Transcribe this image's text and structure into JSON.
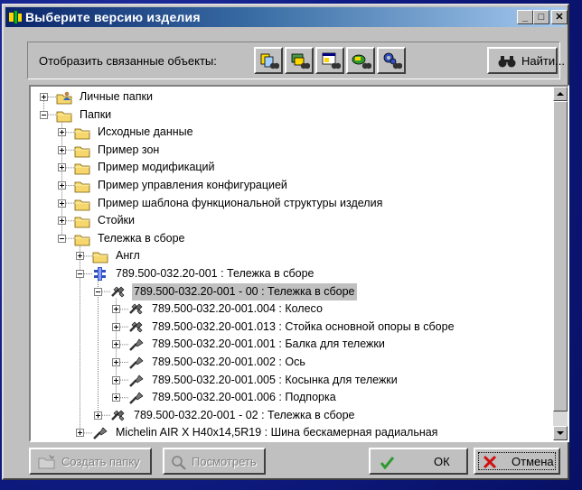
{
  "window": {
    "title": "Выберите версию изделия",
    "minimize_glyph": "_",
    "maximize_glyph": "□",
    "close_glyph": "✕"
  },
  "toolbar": {
    "related_label": "Отобразить связанные объекты:",
    "icon_buttons": [
      "link-objects-icon-1",
      "link-objects-icon-2",
      "link-objects-icon-3",
      "link-objects-icon-4",
      "link-objects-icon-5"
    ],
    "find_label": "Найти..."
  },
  "tree": {
    "nodes": [
      {
        "label": "Личные папки",
        "expander": "plus",
        "icon": "personal-folder-icon"
      },
      {
        "label": "Папки",
        "expander": "minus",
        "icon": "folder-icon"
      },
      {
        "label": "Исходные данные",
        "expander": "plus",
        "icon": "folder-icon"
      },
      {
        "label": "Пример зон",
        "expander": "plus",
        "icon": "folder-icon"
      },
      {
        "label": "Пример модификаций",
        "expander": "plus",
        "icon": "folder-icon"
      },
      {
        "label": "Пример управления конфигурацией",
        "expander": "plus",
        "icon": "folder-icon"
      },
      {
        "label": "Пример шаблона функциональной структуры изделия",
        "expander": "plus",
        "icon": "folder-icon"
      },
      {
        "label": "Стойки",
        "expander": "plus",
        "icon": "folder-icon"
      },
      {
        "label": "Тележка в сборе",
        "expander": "minus",
        "icon": "folder-icon"
      },
      {
        "label": "Англ",
        "expander": "plus",
        "icon": "folder-icon"
      },
      {
        "label": "789.500-032.20-001 : Тележка в сборе",
        "expander": "minus",
        "icon": "product-icon"
      },
      {
        "label": "789.500-032.20-001 - 00 : Тележка в сборе",
        "expander": "minus",
        "icon": "assembly-icon",
        "selected": true
      },
      {
        "label": "789.500-032.20-001.004 : Колесо",
        "expander": "plus",
        "icon": "assembly-icon"
      },
      {
        "label": "789.500-032.20-001.013 : Стойка основной опоры в сборе",
        "expander": "plus",
        "icon": "assembly-icon"
      },
      {
        "label": "789.500-032.20-001.001 : Балка для тележки",
        "expander": "plus",
        "icon": "part-icon"
      },
      {
        "label": "789.500-032.20-001.002 : Ось",
        "expander": "plus",
        "icon": "part-icon"
      },
      {
        "label": "789.500-032.20-001.005 : Косынка для тележки",
        "expander": "plus",
        "icon": "part-icon"
      },
      {
        "label": "789.500-032.20-001.006 : Подпорка",
        "expander": "plus",
        "icon": "part-icon"
      },
      {
        "label": "789.500-032.20-001 - 02 : Тележка в сборе",
        "expander": "plus",
        "icon": "assembly-icon"
      },
      {
        "label": "Michelin AIR X H40x14,5R19 : Шина бескамерная радиальная",
        "expander": "plus",
        "icon": "part-icon"
      }
    ]
  },
  "buttons": {
    "create_folder": "Создать папку",
    "view": "Посмотреть",
    "ok": "ОК",
    "cancel": "Отмена"
  },
  "colors": {
    "desktop": "#0a1670",
    "title_start": "#0a246a",
    "title_end": "#a6caf0",
    "face": "#c0c0c0",
    "folder": "#f5d76e",
    "ok_check": "#2e9a2e",
    "cancel_x": "#d01010"
  }
}
